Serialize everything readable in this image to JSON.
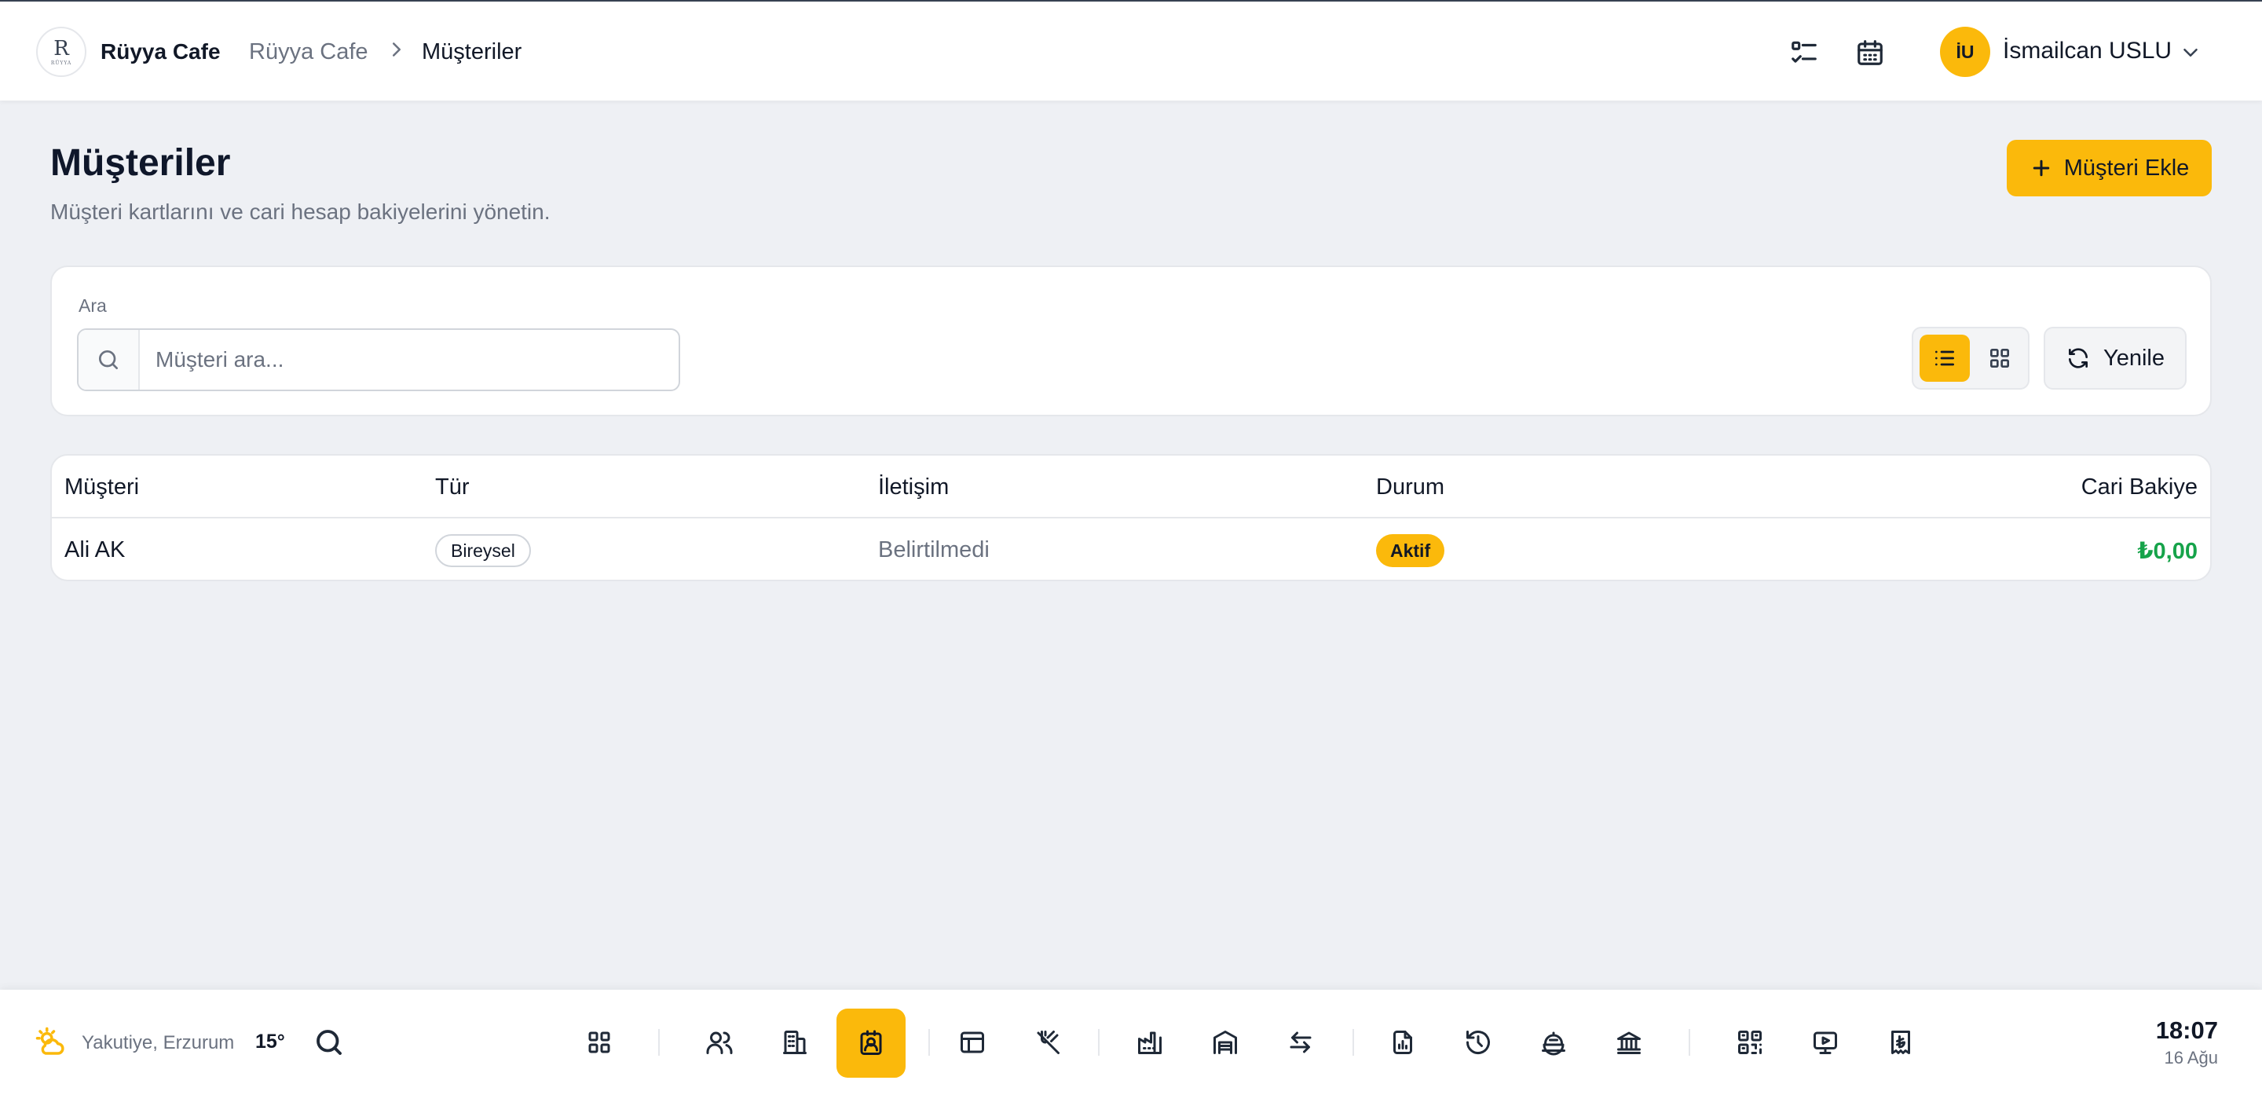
{
  "header": {
    "brand": "Rüyya Cafe",
    "logo_monogram": "R",
    "logo_text": "RÜYYA",
    "breadcrumb": [
      "Rüyya Cafe",
      "Müşteriler"
    ],
    "icons": [
      "checklist-icon",
      "calendar-icon"
    ],
    "user": {
      "initials": "İU",
      "name": "İsmailcan USLU"
    }
  },
  "page": {
    "title": "Müşteriler",
    "subtitle": "Müşteri kartlarını ve cari hesap bakiyelerini yönetin.",
    "add_button": "Müşteri Ekle"
  },
  "search": {
    "label": "Ara",
    "placeholder": "Müşteri ara...",
    "value": "",
    "view_mode": "list",
    "refresh_label": "Yenile"
  },
  "table": {
    "columns": [
      "Müşteri",
      "Tür",
      "İletişim",
      "Durum",
      "Cari Bakiye"
    ],
    "rows": [
      {
        "name": "Ali AK",
        "type": "Bireysel",
        "contact": "Belirtilmedi",
        "status": "Aktif",
        "balance": "₺0,00"
      }
    ]
  },
  "dock": {
    "weather": {
      "location": "Yakutiye, Erzurum",
      "temp": "15°"
    },
    "active_item": "customers-icon",
    "clock": {
      "time": "18:07",
      "date": "16 Ağu"
    }
  },
  "colors": {
    "accent": "#fbb90b",
    "balance_positive": "#16a34a",
    "background": "#eef0f4"
  }
}
